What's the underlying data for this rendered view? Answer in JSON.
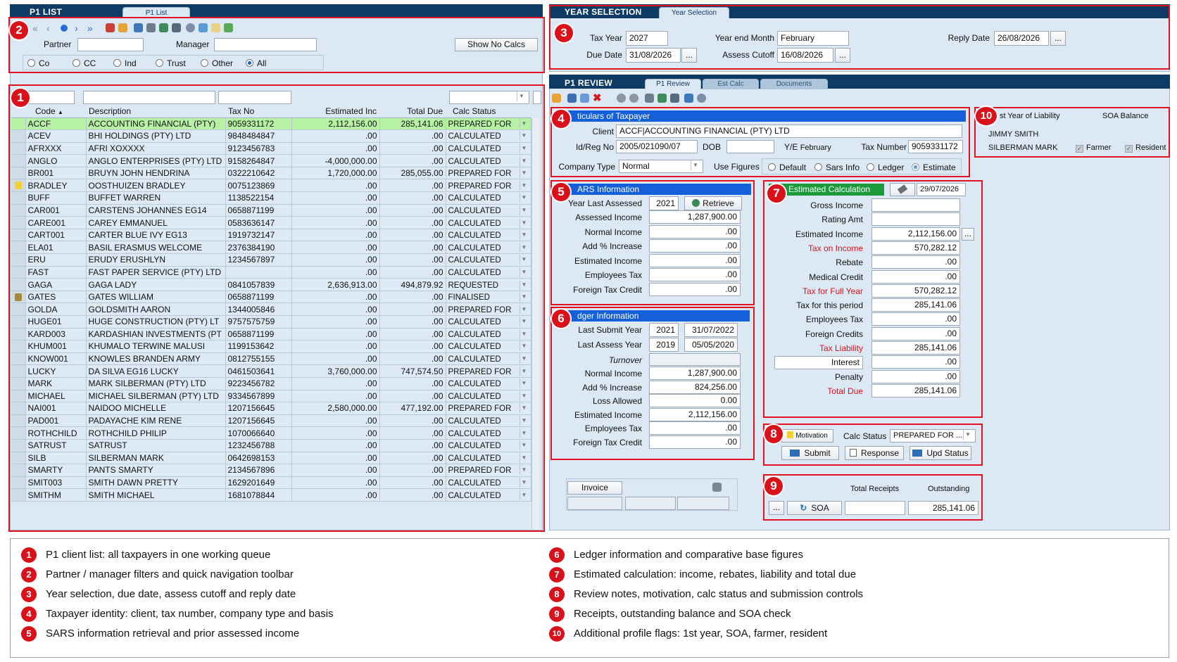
{
  "p1_list": {
    "title": "P1 LIST",
    "tab": "P1 List",
    "partner_label": "Partner",
    "partner_value": "",
    "manager_label": "Manager",
    "manager_value": "",
    "show_no_calcs": "Show No Calcs",
    "filters": [
      "Co",
      "CC",
      "Ind",
      "Trust",
      "Other",
      "All"
    ],
    "selected_filter": "All",
    "columns": [
      "Code",
      "Description",
      "Tax No",
      "Estimated Inc",
      "Total Due",
      "Calc Status"
    ],
    "rows": [
      {
        "code": "ACCF",
        "desc": "ACCOUNTING FINANCIAL (PTY)",
        "taxno": "9059331172",
        "est": "2,112,156.00",
        "due": "285,141.06",
        "status": "PREPARED FOR",
        "sel": true
      },
      {
        "code": "ACEV",
        "desc": "BHI HOLDINGS (PTY) LTD",
        "taxno": "9848484847",
        "est": ".00",
        "due": ".00",
        "status": "CALCULATED"
      },
      {
        "code": "AFRXXX",
        "desc": "AFRI XOXXXX",
        "taxno": "9123456783",
        "est": ".00",
        "due": ".00",
        "status": "CALCULATED"
      },
      {
        "code": "ANGLO",
        "desc": "ANGLO ENTERPRISES (PTY) LTD",
        "taxno": "9158264847",
        "est": "-4,000,000.00",
        "due": ".00",
        "status": "CALCULATED"
      },
      {
        "code": "BR001",
        "desc": "BRUYN JOHN HENDRINA",
        "taxno": "0322210642",
        "est": "1,720,000.00",
        "due": "285,055.00",
        "status": "PREPARED FOR"
      },
      {
        "code": "BRADLEY",
        "desc": "OOSTHUIZEN BRADLEY",
        "taxno": "0075123869",
        "est": ".00",
        "due": ".00",
        "status": "PREPARED FOR",
        "mark": "note"
      },
      {
        "code": "BUFF",
        "desc": "BUFFET WARREN",
        "taxno": "1138522154",
        "est": ".00",
        "due": ".00",
        "status": "CALCULATED"
      },
      {
        "code": "CAR001",
        "desc": "CARSTENS JOHANNES EG14",
        "taxno": "0658871199",
        "est": ".00",
        "due": ".00",
        "status": "CALCULATED"
      },
      {
        "code": "CARE001",
        "desc": "CAREY EMMANUEL",
        "taxno": "0583636147",
        "est": ".00",
        "due": ".00",
        "status": "CALCULATED"
      },
      {
        "code": "CART001",
        "desc": "CARTER BLUE IVY EG13",
        "taxno": "1919732147",
        "est": ".00",
        "due": ".00",
        "status": "CALCULATED"
      },
      {
        "code": "ELA01",
        "desc": "BASIL ERASMUS WELCOME",
        "taxno": "2376384190",
        "est": ".00",
        "due": ".00",
        "status": "CALCULATED"
      },
      {
        "code": "ERU",
        "desc": "ERUDY ERUSHLYN",
        "taxno": "1234567897",
        "est": ".00",
        "due": ".00",
        "status": "CALCULATED"
      },
      {
        "code": "FAST",
        "desc": "FAST PAPER SERVICE (PTY) LTD",
        "taxno": "",
        "est": ".00",
        "due": ".00",
        "status": "CALCULATED"
      },
      {
        "code": "GAGA",
        "desc": "GAGA LADY",
        "taxno": "0841057839",
        "est": "2,636,913.00",
        "due": "494,879.92",
        "status": "REQUESTED"
      },
      {
        "code": "GATES",
        "desc": "GATES WILLIAM",
        "taxno": "0658871199",
        "est": ".00",
        "due": ".00",
        "status": "FINALISED",
        "mark": "lock"
      },
      {
        "code": "GOLDA",
        "desc": "GOLDSMITH AARON",
        "taxno": "1344005846",
        "est": ".00",
        "due": ".00",
        "status": "PREPARED FOR"
      },
      {
        "code": "HUGE01",
        "desc": "HUGE CONSTRUCTION (PTY) LT",
        "taxno": "9757575759",
        "est": ".00",
        "due": ".00",
        "status": "CALCULATED"
      },
      {
        "code": "KARD003",
        "desc": "KARDASHIAN INVESTMENTS (PT",
        "taxno": "0658871199",
        "est": ".00",
        "due": ".00",
        "status": "CALCULATED"
      },
      {
        "code": "KHUM001",
        "desc": "KHUMALO TERWINE MALUSI",
        "taxno": "1199153642",
        "est": ".00",
        "due": ".00",
        "status": "CALCULATED"
      },
      {
        "code": "KNOW001",
        "desc": "KNOWLES BRANDEN ARMY",
        "taxno": "0812755155",
        "est": ".00",
        "due": ".00",
        "status": "CALCULATED"
      },
      {
        "code": "LUCKY",
        "desc": "DA SILVA EG16 LUCKY",
        "taxno": "0461503641",
        "est": "3,760,000.00",
        "due": "747,574.50",
        "status": "PREPARED FOR"
      },
      {
        "code": "MARK",
        "desc": "MARK SILBERMAN (PTY) LTD",
        "taxno": "9223456782",
        "est": ".00",
        "due": ".00",
        "status": "CALCULATED"
      },
      {
        "code": "MICHAEL",
        "desc": "MICHAEL SILBERMAN (PTY) LTD",
        "taxno": "9334567899",
        "est": ".00",
        "due": ".00",
        "status": "CALCULATED"
      },
      {
        "code": "NAI001",
        "desc": "NAIDOO MICHELLE",
        "taxno": "1207156645",
        "est": "2,580,000.00",
        "due": "477,192.00",
        "status": "PREPARED FOR"
      },
      {
        "code": "PAD001",
        "desc": "PADAYACHE KIM RENE",
        "taxno": "1207156645",
        "est": ".00",
        "due": ".00",
        "status": "CALCULATED"
      },
      {
        "code": "ROTHCHILD",
        "desc": "ROTHCHILD PHILIP",
        "taxno": "1070066640",
        "est": ".00",
        "due": ".00",
        "status": "CALCULATED"
      },
      {
        "code": "SATRUST",
        "desc": "SATRUST",
        "taxno": "1232456788",
        "est": ".00",
        "due": ".00",
        "status": "CALCULATED"
      },
      {
        "code": "SILB",
        "desc": "SILBERMAN MARK",
        "taxno": "0642698153",
        "est": ".00",
        "due": ".00",
        "status": "CALCULATED"
      },
      {
        "code": "SMARTY",
        "desc": "PANTS SMARTY",
        "taxno": "2134567896",
        "est": ".00",
        "due": ".00",
        "status": "PREPARED FOR"
      },
      {
        "code": "SMIT003",
        "desc": "SMITH DAWN PRETTY",
        "taxno": "1629201649",
        "est": ".00",
        "due": ".00",
        "status": "CALCULATED"
      },
      {
        "code": "SMITHM",
        "desc": "SMITH MICHAEL",
        "taxno": "1681078844",
        "est": ".00",
        "due": ".00",
        "status": "CALCULATED"
      }
    ]
  },
  "year_selection": {
    "title": "YEAR SELECTION",
    "tab": "Year Selection",
    "tax_year_label": "Tax Year",
    "tax_year": "2027",
    "year_end_label": "Year end Month",
    "year_end": "February",
    "reply_date_label": "Reply Date",
    "reply_date": "26/08/2026",
    "due_date_label": "Due Date",
    "due_date": "31/08/2026",
    "assess_cutoff_label": "Assess Cutoff",
    "assess_cutoff": "16/08/2026",
    "ellipsis": "..."
  },
  "p1_review": {
    "title": "P1 REVIEW",
    "tabs": [
      "P1 Review",
      "Est Calc",
      "Documents"
    ]
  },
  "taxpayer": {
    "header": "ticulars of Taxpayer",
    "client_label": "Client",
    "client": "ACCF|ACCOUNTING FINANCIAL (PTY) LTD",
    "idreg_label": "Id/Reg No",
    "idreg": "2005/021090/07",
    "dob_label": "DOB",
    "dob": "",
    "ye_label": "Y/E",
    "ye": "February",
    "taxnum_label": "Tax Number",
    "taxnum": "9059331172",
    "company_type_label": "Company Type",
    "company_type": "Normal",
    "use_figures_label": "Use Figures",
    "use_figures": [
      "Default",
      "Sars Info",
      "Ledger",
      "Estimate"
    ],
    "use_figures_selected": "Estimate"
  },
  "profile": {
    "first_year_label": "st Year of Liability",
    "soa_label": "SOA Balance",
    "name1": "JIMMY SMITH",
    "name2": "SILBERMAN MARK",
    "farmer_label": "Farmer",
    "resident_label": "Resident"
  },
  "sars": {
    "header": "ARS Information",
    "year_label": "Year Last Assessed",
    "year": "2021",
    "retrieve": "Retrieve",
    "rows": [
      {
        "label": "Assessed Income",
        "value": "1,287,900.00"
      },
      {
        "label": "Normal Income",
        "value": ".00"
      },
      {
        "label": "Add % Increase",
        "value": ".00"
      },
      {
        "label": "Estimated Income",
        "value": ".00"
      },
      {
        "label": "Employees Tax",
        "value": ".00"
      },
      {
        "label": "Foreign Tax Credit",
        "value": ".00"
      }
    ]
  },
  "ledger": {
    "header": "dger Information",
    "last_submit_label": "Last Submit Year",
    "last_submit_year": "2021",
    "last_submit_date": "31/07/2022",
    "last_assess_label": "Last Assess Year",
    "last_assess_year": "2019",
    "last_assess_date": "05/05/2020",
    "turnover_label": "Turnover",
    "rows": [
      {
        "label": "Normal Income",
        "value": "1,287,900.00"
      },
      {
        "label": "Add % Increase",
        "value": "824,256.00"
      },
      {
        "label": "Loss Allowed",
        "value": "0.00"
      },
      {
        "label": "Estimated Income",
        "value": "2,112,156.00"
      },
      {
        "label": "Employees Tax",
        "value": ".00"
      },
      {
        "label": "Foreign Tax Credit",
        "value": ".00"
      }
    ]
  },
  "estimate": {
    "header": "Estimated Calculation",
    "date": "29/07/2026",
    "rows": [
      {
        "label": "Gross Income",
        "value": "",
        "red": false
      },
      {
        "label": "Rating Amt",
        "value": "",
        "red": false
      },
      {
        "label": "Estimated Income",
        "value": "2,112,156.00",
        "red": false
      },
      {
        "label": "Tax on Income",
        "value": "570,282.12",
        "red": true
      },
      {
        "label": "Rebate",
        "value": ".00",
        "red": false
      },
      {
        "label": "Medical Credit",
        "value": ".00",
        "red": false
      },
      {
        "label": "Tax for Full Year",
        "value": "570,282.12",
        "red": true
      },
      {
        "label": "Tax for this period",
        "value": "285,141.06",
        "red": false
      },
      {
        "label": "Employees Tax",
        "value": ".00",
        "red": false
      },
      {
        "label": "Foreign Credits",
        "value": ".00",
        "red": false
      },
      {
        "label": "Tax Liability",
        "value": "285,141.06",
        "red": true
      },
      {
        "label": "Interest",
        "value": ".00",
        "red": false,
        "boxed": true
      },
      {
        "label": "Penalty",
        "value": ".00",
        "red": false
      },
      {
        "label": "Total Due",
        "value": "285,141.06",
        "red": true
      }
    ]
  },
  "status_panel": {
    "motivation": "Motivation",
    "calc_status_label": "Calc Status",
    "calc_status": "PREPARED FOR ...",
    "submit": "Submit",
    "response": "Response",
    "upd_status": "Upd Status"
  },
  "receipts": {
    "total_receipts_label": "Total Receipts",
    "outstanding_label": "Outstanding",
    "soa": "SOA",
    "total_receipts": "",
    "outstanding": "285,141.06"
  },
  "invoice": {
    "label": "Invoice"
  },
  "legend": [
    {
      "n": "1",
      "text": "P1 client list: all taxpayers in one working queue"
    },
    {
      "n": "2",
      "text": "Partner / manager filters and quick navigation toolbar"
    },
    {
      "n": "3",
      "text": "Year selection, due date, assess cutoff and reply date"
    },
    {
      "n": "4",
      "text": "Taxpayer identity: client, tax number, company type and basis"
    },
    {
      "n": "5",
      "text": "SARS information retrieval and prior assessed income"
    },
    {
      "n": "6",
      "text": "Ledger information and comparative base figures"
    },
    {
      "n": "7",
      "text": "Estimated calculation: income, rebates, liability and total due"
    },
    {
      "n": "8",
      "text": "Review notes, motivation, calc status and submission controls"
    },
    {
      "n": "9",
      "text": "Receipts, outstanding balance and SOA check"
    },
    {
      "n": "10",
      "text": "Additional profile flags: 1st year, SOA, farmer, resident"
    }
  ],
  "colors": {
    "header": "#0e3a66",
    "panel": "#dce8f4",
    "callout": "#d8111b",
    "selected_row": "#b7f2a4",
    "section_blue": "#1560d8",
    "section_green": "#1a9a3a"
  }
}
